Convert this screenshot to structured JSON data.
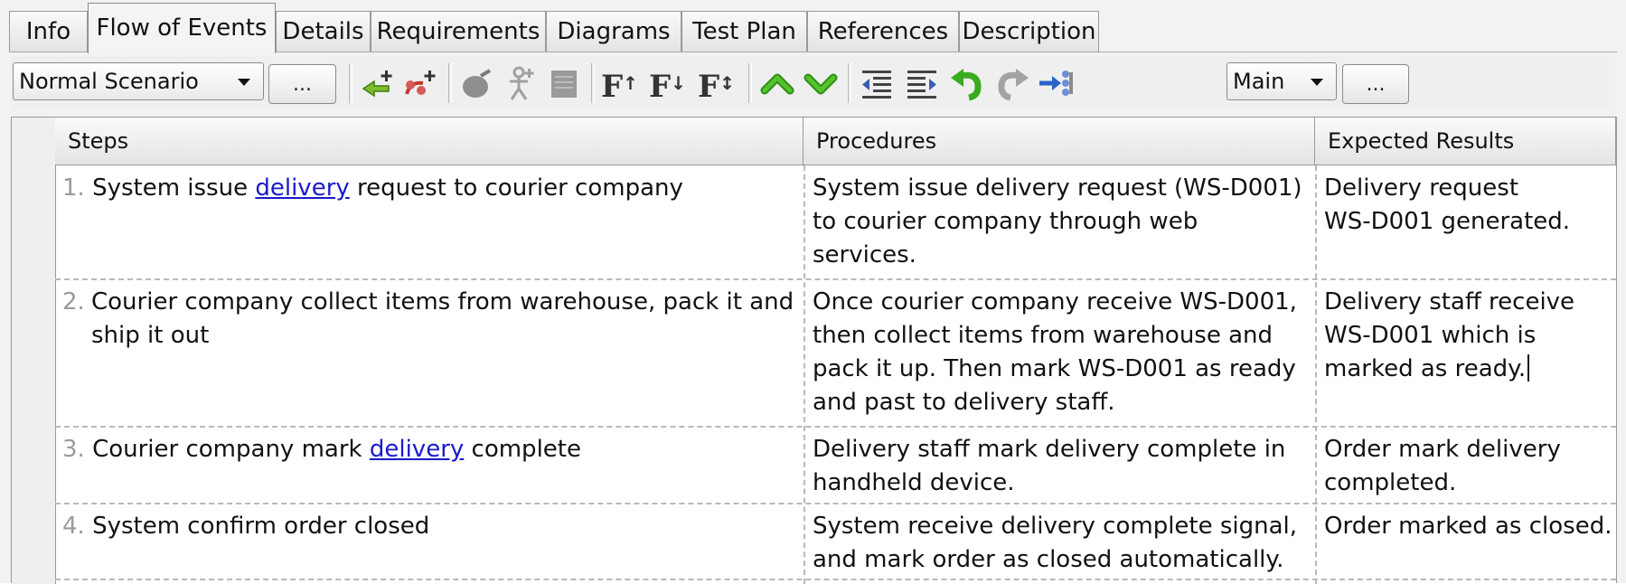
{
  "tabs": [
    {
      "label": "Info"
    },
    {
      "label": "Flow of Events"
    },
    {
      "label": "Details"
    },
    {
      "label": "Requirements"
    },
    {
      "label": "Diagrams"
    },
    {
      "label": "Test Plan"
    },
    {
      "label": "References"
    },
    {
      "label": "Description"
    }
  ],
  "toolbar": {
    "scenario_select": "Normal Scenario",
    "scenario_more": "...",
    "flow_select": "Main",
    "flow_more": "...",
    "icons": [
      "insert-step-icon",
      "insert-sub-step-icon",
      "add-include-icon",
      "add-actor-step-icon",
      "add-note-icon",
      "font-increase-icon",
      "font-decrease-icon",
      "font-reset-icon",
      "move-up-icon",
      "move-down-icon",
      "outdent-icon",
      "indent-icon",
      "undo-icon",
      "redo-icon",
      "extend-icon"
    ]
  },
  "table": {
    "headers": {
      "steps": "Steps",
      "procedures": "Procedures",
      "expected": "Expected Results"
    },
    "rows": [
      {
        "num": "1.",
        "step_pre": "System issue ",
        "step_link": "delivery",
        "step_post": " request to courier company",
        "procedure": "System issue delivery request (WS-D001)\nto courier company through web\nservices.",
        "expected": "Delivery request\nWS-D001 generated."
      },
      {
        "num": "2.",
        "step_pre": "Courier company collect items from warehouse, pack it and\nship it out",
        "step_link": "",
        "step_post": "",
        "procedure": "Once courier company receive WS-D001,\nthen collect items from warehouse and\npack it up. Then mark WS-D001 as ready\nand past to delivery staff.",
        "expected": "Delivery staff receive\nWS-D001 which is\nmarked as ready."
      },
      {
        "num": "3.",
        "step_pre": "Courier company mark ",
        "step_link": "delivery",
        "step_post": " complete",
        "procedure": "Delivery staff mark delivery complete in\nhandheld device.",
        "expected": "Order mark delivery\ncompleted."
      },
      {
        "num": "4.",
        "step_pre": "System confirm order closed",
        "step_link": "",
        "step_post": "",
        "procedure": "System receive delivery complete signal,\nand mark order as closed automatically.",
        "expected": "Order marked as closed."
      }
    ]
  },
  "colors": {
    "link": "#1a1acc",
    "green_arrow": "#3aaa1e",
    "gray_icon": "#9a9a9a"
  }
}
